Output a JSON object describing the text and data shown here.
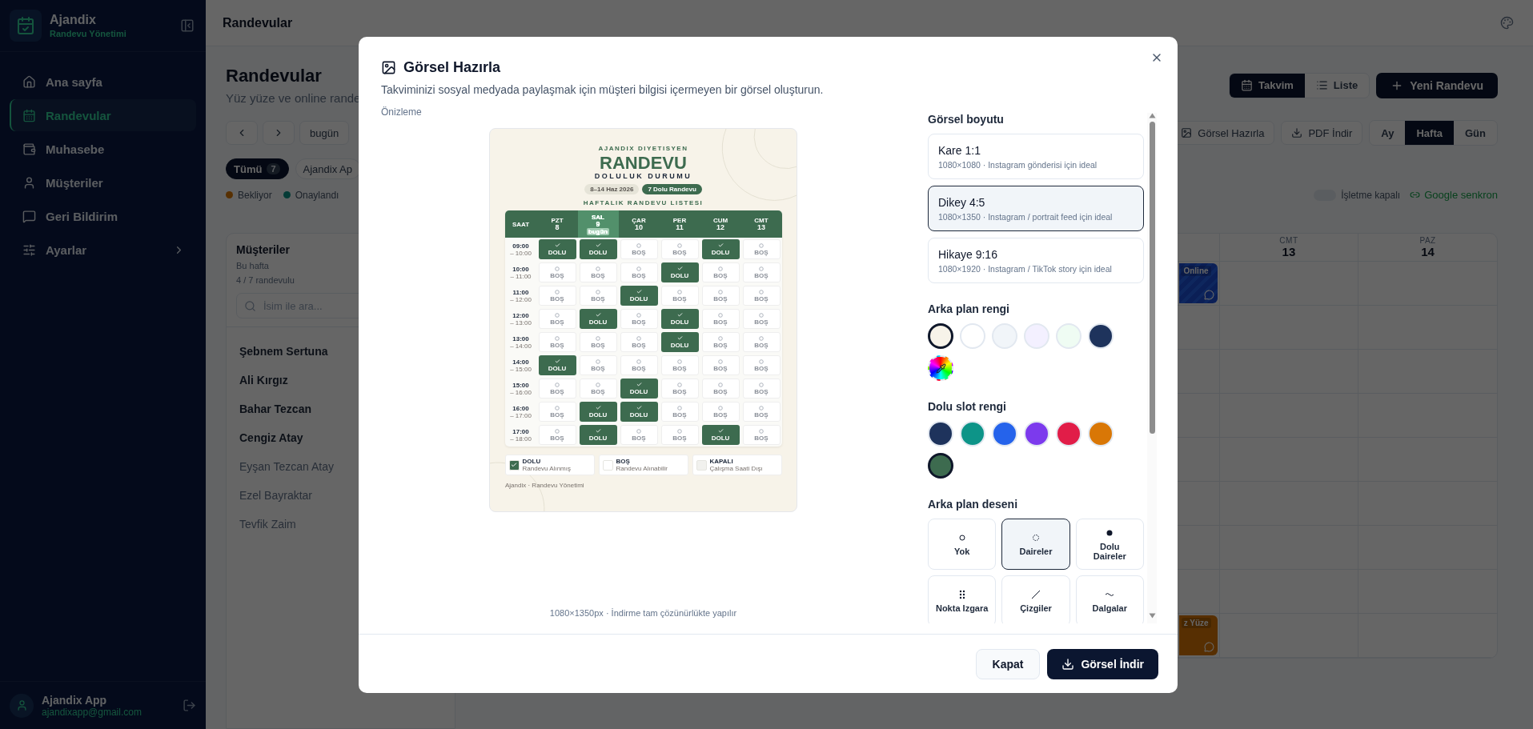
{
  "sidebar": {
    "brand": "Ajandix",
    "tagline": "Randevu Yönetimi",
    "items": [
      {
        "label": "Ana sayfa",
        "selected": false,
        "expandable": false
      },
      {
        "label": "Randevular",
        "selected": true,
        "expandable": false
      },
      {
        "label": "Muhasebe",
        "selected": false,
        "expandable": false
      },
      {
        "label": "Müşteriler",
        "selected": false,
        "expandable": false
      },
      {
        "label": "Geri Bildirim",
        "selected": false,
        "expandable": false
      },
      {
        "label": "Ayarlar",
        "selected": false,
        "expandable": true
      }
    ],
    "user": {
      "name": "Ajandix App",
      "email": "ajandixapp@gmail.com"
    }
  },
  "topbar": {
    "title": "Randevular"
  },
  "page": {
    "title": "Randevular",
    "subtitle": "Yüz yüze ve online rande",
    "today": "bugün",
    "filters": [
      {
        "label": "Tümü",
        "count": "7",
        "selected": true
      },
      {
        "label": "Ajandix Ap",
        "selected": false
      }
    ],
    "legend": [
      {
        "label": "Bekliyor",
        "color": "#573002"
      },
      {
        "label": "Onaylandı",
        "color": "#053b36"
      }
    ],
    "view_toggle": [
      {
        "label": "Takvim",
        "selected": true
      },
      {
        "label": "Liste",
        "selected": false
      }
    ],
    "new_button": "Yeni Randevu",
    "actions": [
      "Görsel Hazırla",
      "PDF İndir"
    ],
    "ranges": [
      {
        "label": "Ay",
        "selected": false
      },
      {
        "label": "Hafta",
        "selected": true
      },
      {
        "label": "Gün",
        "selected": false
      }
    ],
    "closed_toggle": {
      "label": "İşletme kapalı",
      "on": false
    },
    "google_sync": "Google senkron"
  },
  "customers": {
    "title": "Müşteriler",
    "period": "Bu hafta",
    "summary": "4 / 7 randevulu",
    "search": {
      "placeholder": "İsim ile ara..."
    },
    "items": [
      {
        "name": "Şebnem Sertuna",
        "booked": true
      },
      {
        "name": "Ali Kırgız",
        "booked": true
      },
      {
        "name": "Bahar Tezcan",
        "booked": true
      },
      {
        "name": "Cengiz Atay",
        "booked": true
      },
      {
        "name": "Eyşan Tezcan Atay",
        "booked": false
      },
      {
        "name": "Ezel Bayraktar",
        "booked": false
      },
      {
        "name": "Tevfik Zaim",
        "booked": false
      }
    ]
  },
  "calendar": {
    "days": [
      {
        "day": "CMT",
        "date": "13"
      },
      {
        "day": "PAZ",
        "date": "14"
      }
    ],
    "slots": [
      {
        "kind": "online",
        "label": "Online"
      },
      {
        "kind": "empty"
      },
      {
        "kind": "empty"
      },
      {
        "kind": "empty"
      },
      {
        "kind": "empty"
      },
      {
        "kind": "empty"
      },
      {
        "kind": "empty"
      },
      {
        "kind": "empty"
      },
      {
        "kind": "face",
        "label": "z Yüze"
      }
    ]
  },
  "modal": {
    "title": "Görsel Hazırla",
    "description": "Takviminizi sosyal medyada paylaşmak için müşteri bilgisi içermeyen bir görsel oluşturun.",
    "preview_label": "Önizleme",
    "poster": {
      "brand": "AJANDIX DIYETISYEN",
      "title": "RANDEVU",
      "subtitle": "DOLULUK DURUMU",
      "date_range": "8–14 Haz 2026",
      "count": "7 Dolu Randevu",
      "list_title": "HAFTALIK RANDEVU LISTESI",
      "time_header": "SAAT",
      "days": [
        {
          "day": "PZT",
          "date": "8",
          "today": false
        },
        {
          "day": "SAL",
          "date": "9",
          "today": true,
          "badge": "bugün"
        },
        {
          "day": "ÇAR",
          "date": "10",
          "today": false
        },
        {
          "day": "PER",
          "date": "11",
          "today": false
        },
        {
          "day": "CUM",
          "date": "12",
          "today": false
        },
        {
          "day": "CMT",
          "date": "13",
          "today": false
        }
      ],
      "rows": [
        {
          "time": "09:00",
          "end": "– 10:00",
          "cells": [
            {
              "label": "DOLU",
              "booked": true
            },
            {
              "label": "DOLU",
              "booked": true
            },
            {
              "label": "BOŞ",
              "booked": false
            },
            {
              "label": "BOŞ",
              "booked": false
            },
            {
              "label": "DOLU",
              "booked": true
            },
            {
              "label": "BOŞ",
              "booked": false
            }
          ]
        },
        {
          "time": "10:00",
          "end": "– 11:00",
          "cells": [
            {
              "label": "BOŞ",
              "booked": false
            },
            {
              "label": "BOŞ",
              "booked": false
            },
            {
              "label": "BOŞ",
              "booked": false
            },
            {
              "label": "DOLU",
              "booked": true
            },
            {
              "label": "BOŞ",
              "booked": false
            },
            {
              "label": "BOŞ",
              "booked": false
            }
          ]
        },
        {
          "time": "11:00",
          "end": "– 12:00",
          "cells": [
            {
              "label": "BOŞ",
              "booked": false
            },
            {
              "label": "BOŞ",
              "booked": false
            },
            {
              "label": "DOLU",
              "booked": true
            },
            {
              "label": "BOŞ",
              "booked": false
            },
            {
              "label": "BOŞ",
              "booked": false
            },
            {
              "label": "BOŞ",
              "booked": false
            }
          ]
        },
        {
          "time": "12:00",
          "end": "– 13:00",
          "cells": [
            {
              "label": "BOŞ",
              "booked": false
            },
            {
              "label": "DOLU",
              "booked": true
            },
            {
              "label": "BOŞ",
              "booked": false
            },
            {
              "label": "DOLU",
              "booked": true
            },
            {
              "label": "BOŞ",
              "booked": false
            },
            {
              "label": "BOŞ",
              "booked": false
            }
          ]
        },
        {
          "time": "13:00",
          "end": "– 14:00",
          "cells": [
            {
              "label": "BOŞ",
              "booked": false
            },
            {
              "label": "BOŞ",
              "booked": false
            },
            {
              "label": "BOŞ",
              "booked": false
            },
            {
              "label": "DOLU",
              "booked": true
            },
            {
              "label": "BOŞ",
              "booked": false
            },
            {
              "label": "BOŞ",
              "booked": false
            }
          ]
        },
        {
          "time": "14:00",
          "end": "– 15:00",
          "cells": [
            {
              "label": "DOLU",
              "booked": true
            },
            {
              "label": "BOŞ",
              "booked": false
            },
            {
              "label": "BOŞ",
              "booked": false
            },
            {
              "label": "BOŞ",
              "booked": false
            },
            {
              "label": "BOŞ",
              "booked": false
            },
            {
              "label": "BOŞ",
              "booked": false
            }
          ]
        },
        {
          "time": "15:00",
          "end": "– 16:00",
          "cells": [
            {
              "label": "BOŞ",
              "booked": false
            },
            {
              "label": "BOŞ",
              "booked": false
            },
            {
              "label": "DOLU",
              "booked": true
            },
            {
              "label": "BOŞ",
              "booked": false
            },
            {
              "label": "BOŞ",
              "booked": false
            },
            {
              "label": "BOŞ",
              "booked": false
            }
          ]
        },
        {
          "time": "16:00",
          "end": "– 17:00",
          "cells": [
            {
              "label": "BOŞ",
              "booked": false
            },
            {
              "label": "DOLU",
              "booked": true
            },
            {
              "label": "DOLU",
              "booked": true
            },
            {
              "label": "BOŞ",
              "booked": false
            },
            {
              "label": "BOŞ",
              "booked": false
            },
            {
              "label": "BOŞ",
              "booked": false
            }
          ]
        },
        {
          "time": "17:00",
          "end": "– 18:00",
          "cells": [
            {
              "label": "BOŞ",
              "booked": false
            },
            {
              "label": "DOLU",
              "booked": true
            },
            {
              "label": "BOŞ",
              "booked": false
            },
            {
              "label": "BOŞ",
              "booked": false
            },
            {
              "label": "DOLU",
              "booked": true
            },
            {
              "label": "BOŞ",
              "booked": false
            }
          ]
        }
      ],
      "legend": [
        {
          "kind": "booked",
          "label": "DOLU",
          "note": "Randevu Alınmış"
        },
        {
          "kind": "free",
          "label": "BOŞ",
          "note": "Randevu Alınabilir"
        },
        {
          "kind": "closed",
          "label": "KAPALI",
          "note": "Çalışma Saati Dışı"
        }
      ],
      "footer": "Ajandix · Randevu Yönetimi"
    },
    "caption": "1080×1350px · İndirme tam çözünürlükte yapılır",
    "size_label": "Görsel boyutu",
    "sizes": [
      {
        "title": "Kare 1:1",
        "detail": "1080×1080 · Instagram gönderisi için ideal",
        "selected": false
      },
      {
        "title": "Dikey 4:5",
        "detail": "1080×1350 · Instagram / portrait feed için ideal",
        "selected": true
      },
      {
        "title": "Hikaye 9:16",
        "detail": "1080×1920 · Instagram / TikTok story için ideal",
        "selected": false
      }
    ],
    "bg_label": "Arka plan rengi",
    "bg_colors": [
      {
        "kind": "color",
        "color": "#f7f3e9",
        "selected": true
      },
      {
        "kind": "color",
        "color": "#ffffff",
        "selected": false
      },
      {
        "kind": "color",
        "color": "#f1f5f9",
        "selected": false
      },
      {
        "kind": "color",
        "color": "#f3f0ff",
        "selected": false
      },
      {
        "kind": "color",
        "color": "#effcf3",
        "selected": false
      },
      {
        "kind": "color",
        "color": "#1e335c",
        "selected": false
      },
      {
        "kind": "picker",
        "selected": false
      }
    ],
    "slot_label": "Dolu slot rengi",
    "slot_colors": [
      {
        "color": "#1e335c",
        "selected": false
      },
      {
        "color": "#0d9488",
        "selected": false
      },
      {
        "color": "#2563eb",
        "selected": false
      },
      {
        "color": "#7c3aed",
        "selected": false
      },
      {
        "color": "#e11d48",
        "selected": false
      },
      {
        "color": "#d97706",
        "selected": false
      },
      {
        "color": "#3d6b4f",
        "selected": true
      }
    ],
    "pattern_label": "Arka plan deseni",
    "patterns": [
      {
        "label": "Yok",
        "selected": false
      },
      {
        "label": "Daireler",
        "selected": true
      },
      {
        "label": "Dolu Daireler",
        "selected": false
      },
      {
        "label": "Nokta Izgara",
        "selected": false
      },
      {
        "label": "Çizgiler",
        "selected": false
      },
      {
        "label": "Dalgalar",
        "selected": false
      }
    ],
    "close_button": "Kapat",
    "download_button": "Görsel İndir"
  }
}
